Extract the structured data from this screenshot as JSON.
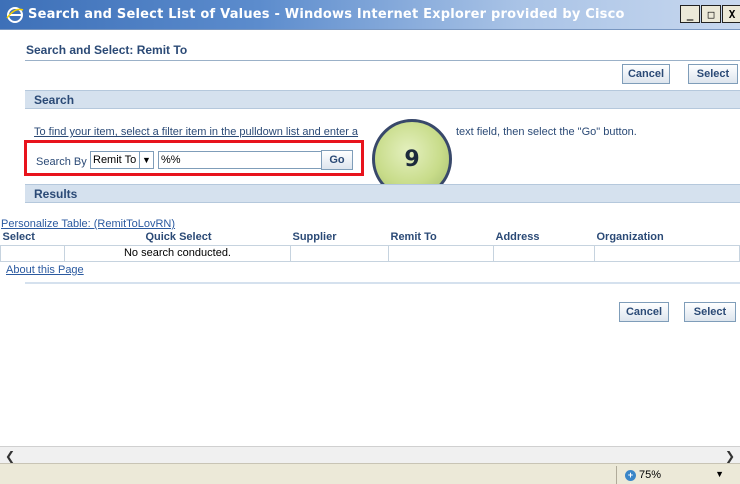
{
  "window": {
    "title": "Search and Select List of Values - Windows Internet Explorer provided by Cisco",
    "minimize": "_",
    "maximize": "□",
    "close": "X"
  },
  "page": {
    "title": "Search and Select: Remit To",
    "cancel_label": "Cancel",
    "select_label": "Select"
  },
  "search": {
    "section_title": "Search",
    "instructions_prefix": "To find your item, select a filter item in the pulldown list and enter a",
    "instructions_suffix": "text field, then select the \"Go\" button.",
    "search_by_label": "Search By",
    "filter_selected": "Remit To",
    "text_value": "%%",
    "go_label": "Go"
  },
  "annotation": {
    "step_number": "9"
  },
  "results": {
    "section_title": "Results",
    "personalize_link": "Personalize Table: (RemitToLovRN)",
    "columns": [
      "Select",
      "Quick Select",
      "Supplier",
      "Remit To",
      "Address",
      "Organization"
    ],
    "empty_message": "No search conducted.",
    "about_link": "About this Page"
  },
  "status": {
    "zoom": "75%"
  },
  "colors": {
    "header_text": "#2b4a76",
    "section_bar": "#d5e1ee",
    "highlight_border": "#e8131c"
  }
}
